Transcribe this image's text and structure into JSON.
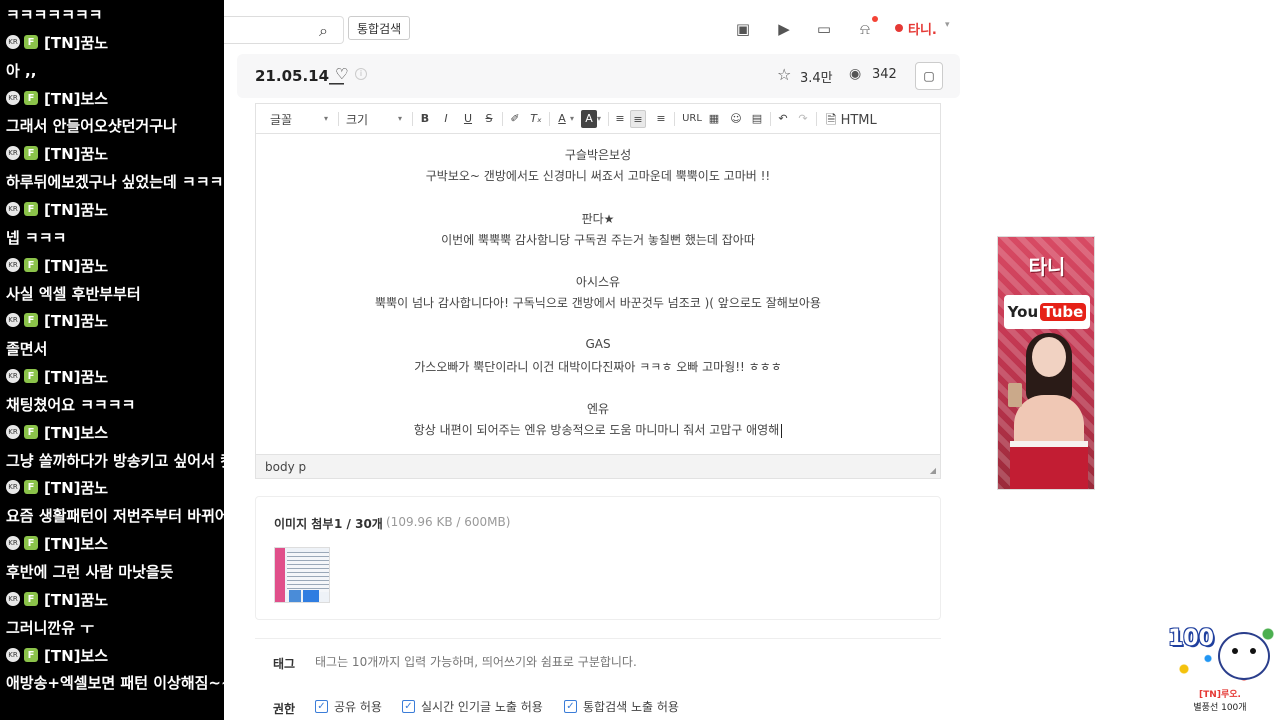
{
  "chat": {
    "badge_circle": "KR",
    "badge_f": "F",
    "lines": [
      {
        "kind": "msg",
        "text": "ㅋㅋㅋㅋㅋㅋㅋ"
      },
      {
        "kind": "user",
        "text": "[TN]꿈노"
      },
      {
        "kind": "msg",
        "text": "아 ,,"
      },
      {
        "kind": "user",
        "text": "[TN]보스"
      },
      {
        "kind": "msg",
        "text": "그래서 안들어오샷던거구나"
      },
      {
        "kind": "user",
        "text": "[TN]꿈노"
      },
      {
        "kind": "msg",
        "text": "하루뒤에보겠구나 싶었는데 ㅋㅋㅋㅋ"
      },
      {
        "kind": "user",
        "text": "[TN]꿈노"
      },
      {
        "kind": "msg",
        "text": "넵 ㅋㅋㅋ"
      },
      {
        "kind": "user",
        "text": "[TN]꿈노"
      },
      {
        "kind": "msg",
        "text": "사실 엑셀 후반부부터"
      },
      {
        "kind": "user",
        "text": "[TN]꿈노"
      },
      {
        "kind": "msg",
        "text": "졸면서"
      },
      {
        "kind": "user",
        "text": "[TN]꿈노"
      },
      {
        "kind": "msg",
        "text": "채팅쳤어요 ㅋㅋㅋㅋ"
      },
      {
        "kind": "user",
        "text": "[TN]보스"
      },
      {
        "kind": "msg",
        "text": "그냥 쏠까하다가 방송키고 싶어서 컷대용"
      },
      {
        "kind": "user",
        "text": "[TN]꿈노"
      },
      {
        "kind": "msg",
        "text": "요즘 생활패턴이 저번주부터 바뀌어가지구"
      },
      {
        "kind": "user",
        "text": "[TN]보스"
      },
      {
        "kind": "msg",
        "text": "후반에 그런 사람 마낫을듯"
      },
      {
        "kind": "user",
        "text": "[TN]꿈노"
      },
      {
        "kind": "msg",
        "text": "그러니깐유 ㅜ"
      },
      {
        "kind": "user",
        "text": "[TN]보스"
      },
      {
        "kind": "msg",
        "text": "애방송+엑셀보면 패턴 이상해짐~~"
      }
    ]
  },
  "header": {
    "search_placeholder": "",
    "search_button": "통합검색",
    "user_name": "타니."
  },
  "post": {
    "title": "21.05.14__",
    "likes": "3.4만",
    "views": "342"
  },
  "toolbar": {
    "font_label": "글꼴",
    "size_label": "크기",
    "url_label": "URL",
    "html_label": "HTML"
  },
  "content": {
    "lines": [
      "구슬박은보성",
      "구박보오~ 갠방에서도 신경마니 써죠서 고마운데 뿍뿍이도 고마버 !!",
      "판다★",
      "이번에 뿍뿍뿍 감사함니당 구독권 주는거 놓칠뻔 했는데 잡아따",
      "아시스유",
      "뿍뿍이 넘나 감사합니다아! 구독닉으로 갠방에서 바꾼것두 넘조코 )( 앞으로도 잘해보아용",
      "GAS",
      "가스오빠가 뿍단이라니 이건 대박이다진짜아 ㅋㅋㅎ 오빠 고마웡!! ㅎㅎㅎ",
      "엔유",
      "항상 내편이 되어주는 엔유 방송적으로 도움 마니마니 줘서 고맙구 애영해"
    ],
    "status_path": "body  p"
  },
  "attachments": {
    "label": "이미지 첨부",
    "count": "1 / 30개",
    "size": "(109.96 KB / 600MB)"
  },
  "tags": {
    "label": "태그",
    "placeholder": "태그는 10개까지 입력 가능하며, 띄어쓰기와 쉼표로 구분합니다."
  },
  "permissions": {
    "label": "권한",
    "items": [
      "공유 허용",
      "실시간 인기글 노출 허용",
      "통합검색 노출 허용"
    ]
  },
  "ad": {
    "top_text": "타니",
    "logo_you": "You",
    "logo_tube": "Tube"
  },
  "sticker": {
    "number": "100",
    "line1": "[TN]루오.",
    "line2": "별풍선 100개"
  }
}
